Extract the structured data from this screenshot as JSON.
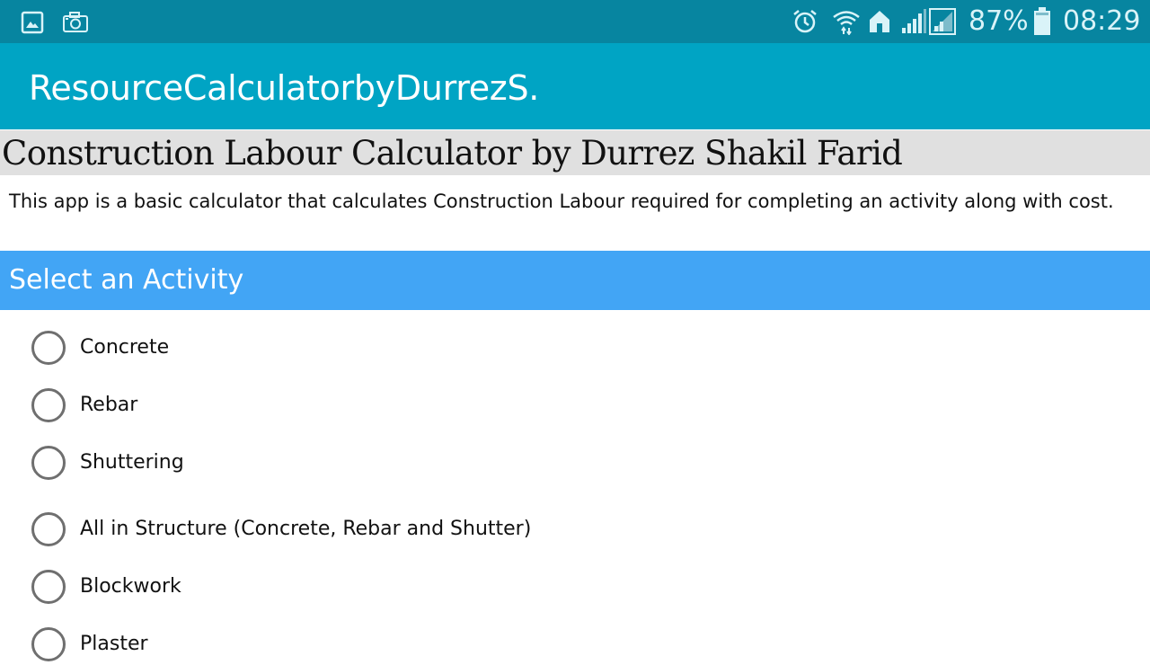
{
  "status_bar": {
    "left_icons": [
      "gallery-icon",
      "camera-icon"
    ],
    "right_icons": [
      "alarm-icon",
      "wifi-icon",
      "home-network-icon",
      "signal-icon",
      "signal-2-icon",
      "battery-icon"
    ],
    "battery_text": "87%",
    "time": "08:29"
  },
  "app_bar": {
    "title": "ResourceCalculatorbyDurrezS."
  },
  "heading": "Construction Labour Calculator by Durrez Shakil Farid",
  "description": "This app is a basic calculator that calculates Construction Labour required for completing an activity along with cost.",
  "section": {
    "title": "Select an Activity"
  },
  "activities": [
    {
      "label": "Concrete",
      "selected": false
    },
    {
      "label": "Rebar",
      "selected": false
    },
    {
      "label": "Shuttering",
      "selected": false
    },
    {
      "label": "All in Structure (Concrete, Rebar and Shutter)",
      "selected": false
    },
    {
      "label": "Blockwork",
      "selected": false
    },
    {
      "label": "Plaster",
      "selected": false
    }
  ],
  "colors": {
    "status_bar": "#0785a0",
    "app_bar": "#00a4c4",
    "heading_bar": "#e0e0e0",
    "section_bar": "#42a5f5"
  }
}
